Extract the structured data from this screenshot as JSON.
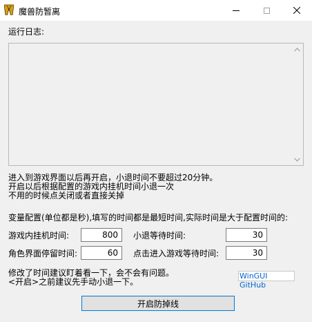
{
  "window": {
    "title": "魔兽防暂离"
  },
  "log": {
    "label": "运行日志:"
  },
  "notes": [
    "进入到游戏界面以后再开启，小退时间不要超过20分钟。",
    "开启以后根据配置的游戏内挂机时间小退一次",
    "不用的时候点关闭或者直接关掉"
  ],
  "config": {
    "heading": "变量配置(单位都是秒),填写的时间都是最短时间,实际时间是大于配置时间的:",
    "fields": [
      {
        "label": "游戏内挂机时间:",
        "value": "800"
      },
      {
        "label": "小退等待时间:",
        "value": "30"
      },
      {
        "label": "角色界面停留时间:",
        "value": "60"
      },
      {
        "label": "点击进入游戏等待时间:",
        "value": "30"
      }
    ]
  },
  "hints": [
    "修改了时间建议盯着看一下，会不会有问题。",
    "<开启>之前建议先手动小退一下。"
  ],
  "link": {
    "label": "WinGUI GitHub"
  },
  "start_button": {
    "label": "开启防掉线"
  },
  "icons": {
    "app": "warcraft-w-logo-icon",
    "minimize": "minimize-icon",
    "maximize": "maximize-icon",
    "close": "close-icon",
    "scroll_up": "chevron-up-icon",
    "scroll_down": "chevron-down-icon"
  },
  "colors": {
    "window_bg": "#f0f0f0",
    "titlebar_bg": "#ffffff",
    "button_bg": "#e1e1e1",
    "focus_border": "#0078d7",
    "link": "#0066cc",
    "logo_gold": "#d4a017",
    "logo_dark": "#5a3a0a"
  }
}
